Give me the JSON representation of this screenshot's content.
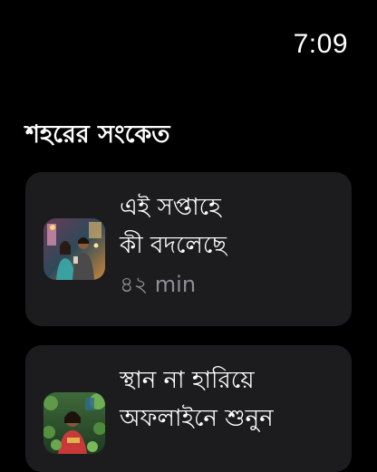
{
  "status_bar": {
    "time": "7:09"
  },
  "section": {
    "title": "শহরের সংকেত"
  },
  "episodes": [
    {
      "title_line1": "এই সপ্তাহে",
      "title_line2": "কী বদলেছে",
      "duration": "৪২ min",
      "thumbnail_icon": "episode-artwork-couple"
    },
    {
      "title_line1": "স্থান না হারিয়ে",
      "title_line2": "অফলাইনে শুনুন",
      "thumbnail_icon": "episode-artwork-woman-plants"
    }
  ],
  "colors": {
    "background": "#000000",
    "card": "#1c1c1e",
    "secondary_text": "#8e8e93"
  }
}
